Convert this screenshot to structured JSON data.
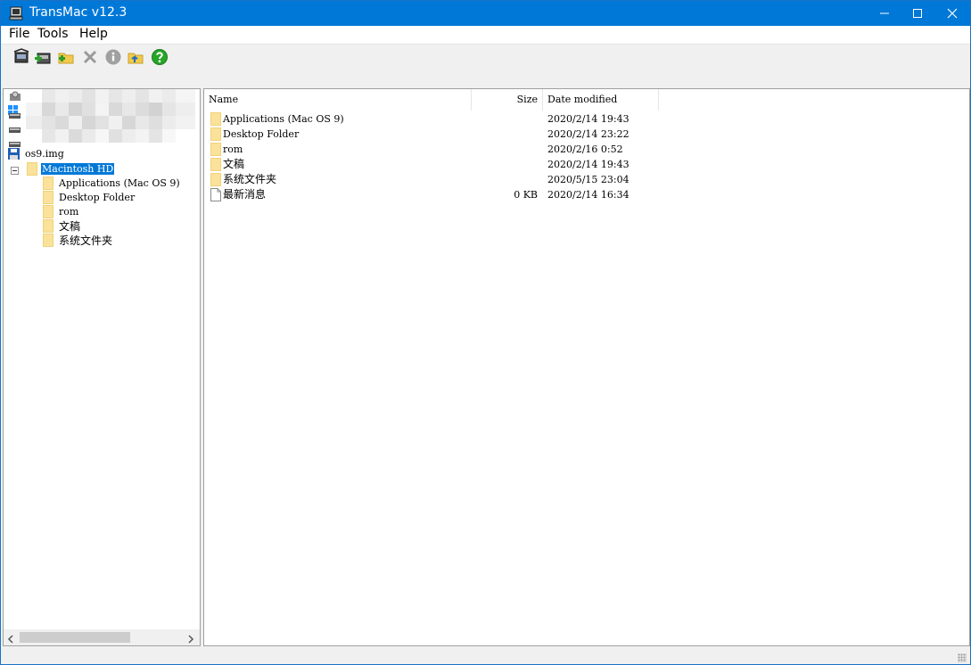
{
  "window": {
    "title": "TransMac v12.3",
    "accent_color": "#0078d7",
    "controls": [
      "minimize-icon",
      "maximize-icon",
      "close-icon"
    ]
  },
  "menu": {
    "items": [
      "File",
      "Tools",
      "Help"
    ]
  },
  "toolbar": {
    "buttons": [
      "open-disk-image-icon",
      "add-disk-icon",
      "new-folder-icon",
      "delete-icon",
      "info-icon",
      "open-folder-icon",
      "help-icon"
    ]
  },
  "tree": {
    "image_file": "os9.img",
    "volume": "Macintosh HD",
    "expander": "⊟",
    "children": [
      {
        "label": "Applications (Mac OS 9)"
      },
      {
        "label": "Desktop Folder"
      },
      {
        "label": "rom"
      },
      {
        "label": "文稿"
      },
      {
        "label": "系统文件夹"
      }
    ]
  },
  "list": {
    "columns": {
      "name": "Name",
      "size": "Size",
      "date": "Date modified"
    },
    "rows": [
      {
        "name": "Applications (Mac OS 9)",
        "size": "",
        "date": "2020/2/14 19:43",
        "type": "folder"
      },
      {
        "name": "Desktop Folder",
        "size": "",
        "date": "2020/2/14 23:22",
        "type": "folder"
      },
      {
        "name": "rom",
        "size": "",
        "date": "2020/2/16 0:52",
        "type": "folder"
      },
      {
        "name": "文稿",
        "size": "",
        "date": "2020/2/14 19:43",
        "type": "folder"
      },
      {
        "name": "系统文件夹",
        "size": "",
        "date": "2020/5/15 23:04",
        "type": "folder"
      },
      {
        "name": "最新消息",
        "size": "0 KB",
        "date": "2020/2/14 16:34",
        "type": "file"
      }
    ]
  },
  "colors": {
    "folder": "#fbe29a",
    "selection": "#0078d7"
  }
}
